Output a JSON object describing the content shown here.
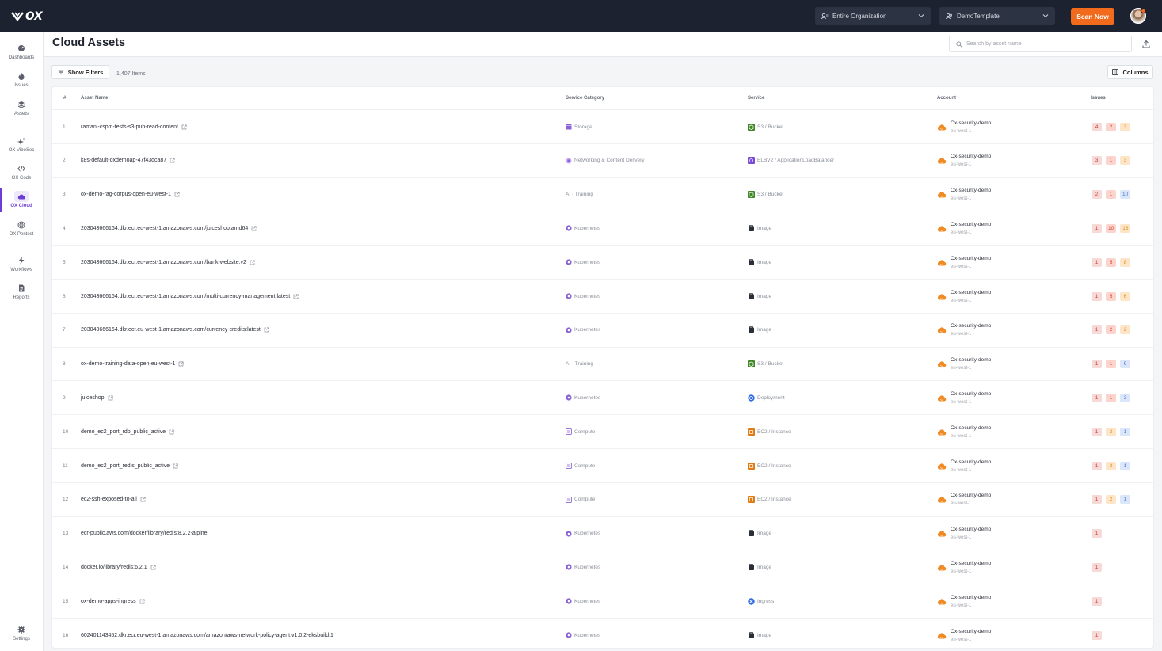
{
  "app": {
    "logo_text": "ox"
  },
  "topbar": {
    "org_selector": "Entire Organization",
    "template_selector": "DemoTemplate",
    "scan_label": "Scan Now"
  },
  "sidebar": {
    "items": [
      {
        "label": "Dashboards",
        "icon": "dashboard-icon"
      },
      {
        "label": "Issues",
        "icon": "flame-icon"
      },
      {
        "label": "Assets",
        "icon": "layers-icon"
      },
      {
        "label": "OX VibeSec",
        "icon": "sparkle-icon"
      },
      {
        "label": "OX Code",
        "icon": "code-icon"
      },
      {
        "label": "OX Cloud",
        "icon": "cloud-icon"
      },
      {
        "label": "OX Pentest",
        "icon": "target-icon"
      },
      {
        "label": "Workflows",
        "icon": "bolt-icon"
      },
      {
        "label": "Reports",
        "icon": "report-icon"
      },
      {
        "label": "Settings",
        "icon": "gear-icon"
      }
    ],
    "active": "OX Cloud"
  },
  "header": {
    "title": "Cloud Assets",
    "search_placeholder": "Search by asset name"
  },
  "toolbar": {
    "filters_label": "Show Filters",
    "count": "1,407 Items",
    "columns_label": "Columns"
  },
  "table": {
    "columns": [
      "#",
      "Asset Name",
      "Service Category",
      "Service",
      "Account",
      "Issues"
    ],
    "rows": [
      {
        "num": "1",
        "name": "ramanl-cspm-tests-s3-pub-read-content",
        "ext": true,
        "category": "Storage",
        "cat_icon": "storage",
        "service": "S3 / Bucket",
        "svc_icon": "s3",
        "account": "Ox-security-demo",
        "region": "eu-west-1",
        "issues": [
          [
            "crit",
            "4"
          ],
          [
            "high",
            "2"
          ],
          [
            "med",
            "3"
          ]
        ]
      },
      {
        "num": "2",
        "name": "k8s-default-oxdemoap-47f43dca87",
        "ext": true,
        "category": "Networking & Content Delivery",
        "cat_icon": "network",
        "service": "ELBV2 / ApplicationLoadBalancer",
        "svc_icon": "elb",
        "account": "Ox-security-demo",
        "region": "eu-west-1",
        "issues": [
          [
            "crit",
            "3"
          ],
          [
            "high",
            "1"
          ],
          [
            "med",
            "3"
          ]
        ]
      },
      {
        "num": "3",
        "name": "ox-demo-rag-corpus-open-eu-west-1",
        "ext": true,
        "category": "AI - Training",
        "cat_icon": "none",
        "service": "S3 / Bucket",
        "svc_icon": "s3",
        "account": "Ox-security-demo",
        "region": "eu-west-1",
        "issues": [
          [
            "crit",
            "2"
          ],
          [
            "high",
            "1"
          ],
          [
            "low",
            "10"
          ]
        ]
      },
      {
        "num": "4",
        "name": "203043666164.dkr.ecr.eu-west-1.amazonaws.com/juiceshop:amd64",
        "ext": true,
        "category": "Kubernetes",
        "cat_icon": "k8s",
        "service": "Image",
        "svc_icon": "image",
        "account": "Ox-security-demo",
        "region": "eu-west-1",
        "issues": [
          [
            "crit",
            "1"
          ],
          [
            "high",
            "10"
          ],
          [
            "med",
            "16"
          ]
        ]
      },
      {
        "num": "5",
        "name": "203043666164.dkr.ecr.eu-west-1.amazonaws.com/bank-website:v2",
        "ext": true,
        "category": "Kubernetes",
        "cat_icon": "k8s",
        "service": "Image",
        "svc_icon": "image",
        "account": "Ox-security-demo",
        "region": "eu-west-1",
        "issues": [
          [
            "crit",
            "1"
          ],
          [
            "high",
            "5"
          ],
          [
            "med",
            "8"
          ]
        ]
      },
      {
        "num": "6",
        "name": "203043666164.dkr.ecr.eu-west-1.amazonaws.com/multi-currency-management:latest",
        "ext": true,
        "category": "Kubernetes",
        "cat_icon": "k8s",
        "service": "Image",
        "svc_icon": "image",
        "account": "Ox-security-demo",
        "region": "eu-west-1",
        "issues": [
          [
            "crit",
            "1"
          ],
          [
            "high",
            "5"
          ],
          [
            "med",
            "6"
          ]
        ]
      },
      {
        "num": "7",
        "name": "203043666164.dkr.ecr.eu-west-1.amazonaws.com/currency-credits:latest",
        "ext": true,
        "category": "Kubernetes",
        "cat_icon": "k8s",
        "service": "Image",
        "svc_icon": "image",
        "account": "Ox-security-demo",
        "region": "eu-west-1",
        "issues": [
          [
            "crit",
            "1"
          ],
          [
            "high",
            "2"
          ],
          [
            "med",
            "2"
          ]
        ]
      },
      {
        "num": "8",
        "name": "ox-demo-training-data-open-eu-west-1",
        "ext": true,
        "category": "AI - Training",
        "cat_icon": "none",
        "service": "S3 / Bucket",
        "svc_icon": "s3",
        "account": "Ox-security-demo",
        "region": "eu-west-1",
        "issues": [
          [
            "crit",
            "1"
          ],
          [
            "high",
            "1"
          ],
          [
            "low",
            "9"
          ]
        ]
      },
      {
        "num": "9",
        "name": "juiceshop",
        "ext": true,
        "category": "Kubernetes",
        "cat_icon": "k8s",
        "service": "Deployment",
        "svc_icon": "deploy",
        "account": "Ox-security-demo",
        "region": "eu-west-1",
        "issues": [
          [
            "crit",
            "1"
          ],
          [
            "high",
            "1"
          ],
          [
            "low",
            "3"
          ]
        ]
      },
      {
        "num": "10",
        "name": "demo_ec2_port_rdp_public_active",
        "ext": true,
        "category": "Compute",
        "cat_icon": "compute",
        "service": "EC2 / Instance",
        "svc_icon": "ec2",
        "account": "Ox-security-demo",
        "region": "eu-west-1",
        "issues": [
          [
            "crit",
            "1"
          ],
          [
            "med",
            "3"
          ],
          [
            "low",
            "1"
          ]
        ]
      },
      {
        "num": "11",
        "name": "demo_ec2_port_redis_public_active",
        "ext": true,
        "category": "Compute",
        "cat_icon": "compute",
        "service": "EC2 / Instance",
        "svc_icon": "ec2",
        "account": "Ox-security-demo",
        "region": "eu-west-1",
        "issues": [
          [
            "crit",
            "1"
          ],
          [
            "med",
            "3"
          ],
          [
            "low",
            "1"
          ]
        ]
      },
      {
        "num": "12",
        "name": "ec2-ssh-exposed-to-all",
        "ext": true,
        "category": "Compute",
        "cat_icon": "compute",
        "service": "EC2 / Instance",
        "svc_icon": "ec2",
        "account": "Ox-security-demo",
        "region": "eu-west-1",
        "issues": [
          [
            "crit",
            "1"
          ],
          [
            "med",
            "2"
          ],
          [
            "low",
            "1"
          ]
        ]
      },
      {
        "num": "13",
        "name": "ecr-public.aws.com/docker/library/redis:8.2.2-alpine",
        "ext": false,
        "category": "Kubernetes",
        "cat_icon": "k8s",
        "service": "Image",
        "svc_icon": "image",
        "account": "Ox-security-demo",
        "region": "eu-west-1",
        "issues": [
          [
            "crit",
            "1"
          ]
        ]
      },
      {
        "num": "14",
        "name": "docker.io/library/redis:6.2.1",
        "ext": true,
        "category": "Kubernetes",
        "cat_icon": "k8s",
        "service": "Image",
        "svc_icon": "image",
        "account": "Ox-security-demo",
        "region": "eu-west-1",
        "issues": [
          [
            "crit",
            "1"
          ]
        ]
      },
      {
        "num": "15",
        "name": "ox-demo-apps-ingress",
        "ext": true,
        "category": "Kubernetes",
        "cat_icon": "k8s",
        "service": "Ingress",
        "svc_icon": "ingress",
        "account": "Ox-security-demo",
        "region": "eu-west-1",
        "issues": [
          [
            "crit",
            "1"
          ]
        ]
      },
      {
        "num": "16",
        "name": "602401143452.dkr.ecr.eu-west-1.amazonaws.com/amazon/aws-network-policy-agent:v1.0.2-eksbuild.1",
        "ext": false,
        "category": "Kubernetes",
        "cat_icon": "k8s",
        "service": "Image",
        "svc_icon": "image",
        "account": "Ox-security-demo",
        "region": "eu-west-1",
        "issues": [
          [
            "crit",
            "1"
          ]
        ]
      }
    ]
  },
  "colors": {
    "topbar": "#1c2230",
    "accent": "#f26a1b",
    "active_nav": "#6b3fd6"
  }
}
